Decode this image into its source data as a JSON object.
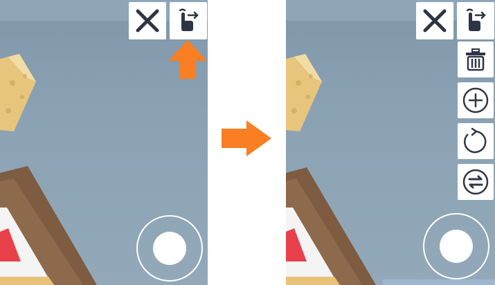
{
  "comparison": {
    "before": {
      "buttons": {
        "close_icon": "close-icon",
        "hand_icon": "hand-pointer-arrow-icon"
      },
      "highlight_arrow": {
        "color": "#fa7e22",
        "direction": "up"
      }
    },
    "after": {
      "buttons": {
        "close_icon": "close-icon",
        "hand_icon": "hand-pointer-arrow-icon",
        "delete_icon": "trash-icon",
        "add_icon": "plus-circle-icon",
        "rotate_icon": "rotate-icon",
        "swap_icon": "swap-arrows-icon"
      }
    },
    "transition_arrow": {
      "color": "#fa7e22",
      "direction": "right"
    }
  },
  "colors": {
    "icon": "#2d3545",
    "accent": "#fa7e22",
    "sky": "#8aa2b3",
    "wood": "#7a5a40",
    "red_flag": "#e8404a"
  }
}
